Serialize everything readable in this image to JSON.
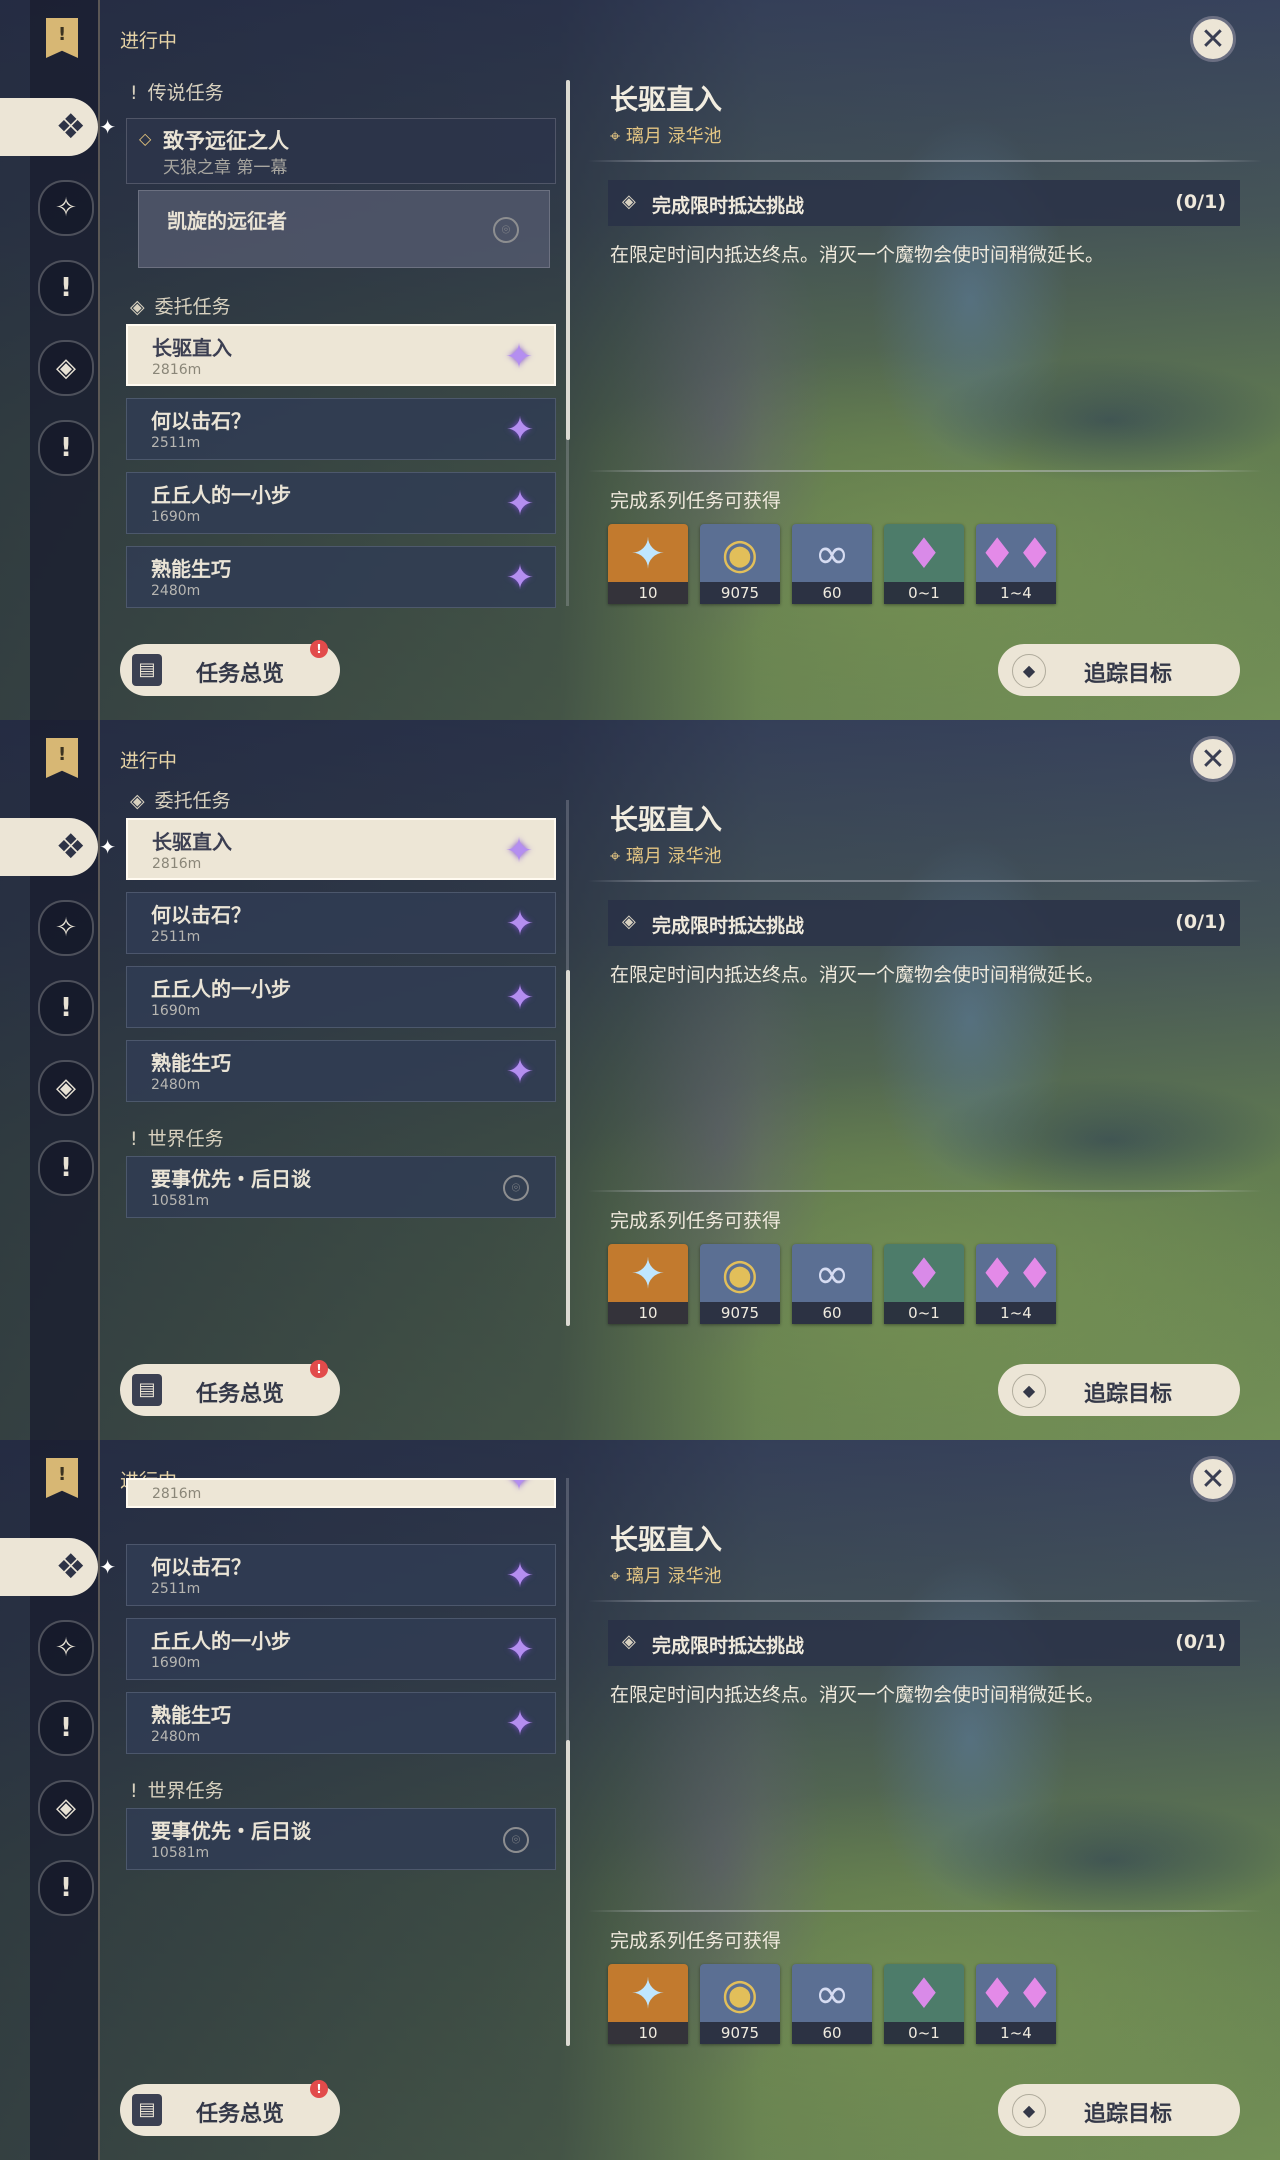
{
  "header": {
    "status_title": "进行中",
    "close_label": "✕"
  },
  "rail": {
    "icons": [
      "quest-book-icon",
      "commission-icon",
      "archon-icon",
      "legend-icon",
      "story-icon",
      "world-icon"
    ]
  },
  "sections": {
    "legend": "传说任务",
    "commission": "委托任务",
    "world": "世界任务"
  },
  "legend_quest": {
    "title": "致予远征之人",
    "subtitle": "天狼之章 第一幕",
    "sub_title": "凯旋的远征者"
  },
  "quests": [
    {
      "title": "长驱直入",
      "distance": "2816m"
    },
    {
      "title": "何以击石？",
      "distance": "2511m"
    },
    {
      "title": "丘丘人的一小步",
      "distance": "1690m"
    },
    {
      "title": "熟能生巧",
      "distance": "2480m"
    }
  ],
  "world_quest": {
    "title": "要事优先・后日谈",
    "distance": "10581m"
  },
  "detail": {
    "title": "长驱直入",
    "location": "璃月 渌华池",
    "objective": "完成限时抵达挑战",
    "objective_count": "(0/1)",
    "description": "在限定时间内抵达终点。消灭一个魔物会使时间稍微延长。",
    "reward_title": "完成系列任务可获得",
    "rewards": [
      {
        "icon": "primogem-icon",
        "count": "10",
        "color": "#c27a2e"
      },
      {
        "icon": "mora-icon",
        "count": "9075",
        "color": "#5b6f93"
      },
      {
        "icon": "fetters-icon",
        "count": "60",
        "color": "#5b6f93"
      },
      {
        "icon": "crystal-small-icon",
        "count": "0~1",
        "color": "#4d7c6a"
      },
      {
        "icon": "crystal-large-icon",
        "count": "1~4",
        "color": "#5b6f93"
      }
    ]
  },
  "buttons": {
    "overview": "任务总览",
    "track": "追踪目标",
    "badge": "!"
  }
}
